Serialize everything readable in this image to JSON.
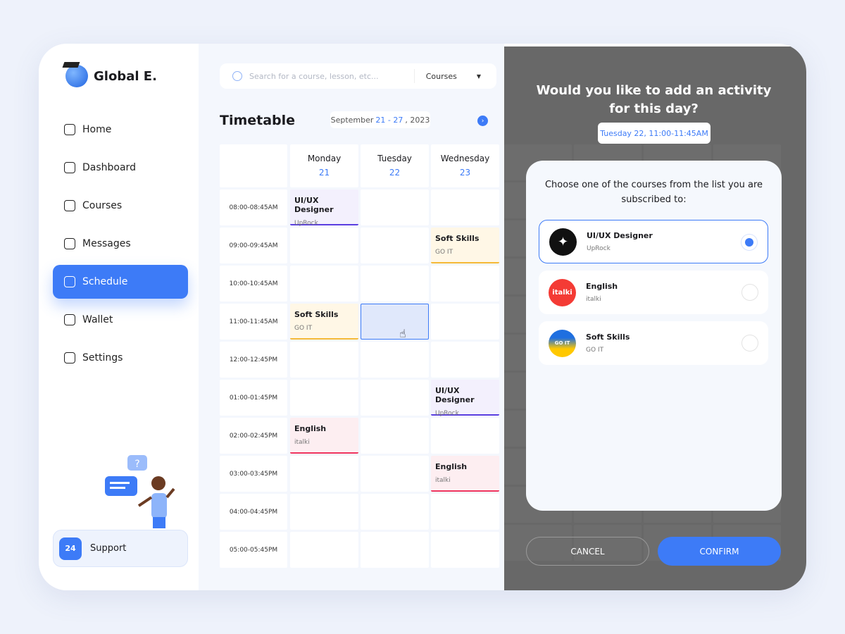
{
  "app": {
    "name": "Global E."
  },
  "sidebar": {
    "items": [
      {
        "label": "Home"
      },
      {
        "label": "Dashboard"
      },
      {
        "label": "Courses"
      },
      {
        "label": "Messages"
      },
      {
        "label": "Schedule",
        "active": true
      },
      {
        "label": "Wallet"
      },
      {
        "label": "Settings"
      }
    ],
    "support": {
      "label": "Support",
      "icon_text": "24"
    }
  },
  "search": {
    "placeholder": "Search for a course, lesson, etc...",
    "filter": "Courses"
  },
  "timetable": {
    "title": "Timetable",
    "range_prefix": "September",
    "range_days": "21 - 27",
    "range_suffix": ", 2023",
    "days": [
      {
        "name": "Monday",
        "date": "21"
      },
      {
        "name": "Tuesday",
        "date": "22"
      },
      {
        "name": "Wednesday",
        "date": "23"
      }
    ],
    "times": [
      "08:00-08:45AM",
      "09:00-09:45AM",
      "10:00-10:45AM",
      "11:00-11:45AM",
      "12:00-12:45PM",
      "01:00-01:45PM",
      "02:00-02:45PM",
      "03:00-03:45PM",
      "04:00-04:45PM",
      "05:00-05:45PM"
    ],
    "events": [
      {
        "day": 0,
        "slot": 0,
        "title": "UI/UX Designer",
        "provider": "UpRock",
        "kind": "uiux"
      },
      {
        "day": 2,
        "slot": 1,
        "title": "Soft Skills",
        "provider": "GO IT",
        "kind": "soft"
      },
      {
        "day": 0,
        "slot": 3,
        "title": "Soft Skills",
        "provider": "GO IT",
        "kind": "soft"
      },
      {
        "day": 2,
        "slot": 5,
        "title": "UI/UX Designer",
        "provider": "UpRock",
        "kind": "uiux"
      },
      {
        "day": 0,
        "slot": 6,
        "title": "English",
        "provider": "italki",
        "kind": "english"
      },
      {
        "day": 2,
        "slot": 7,
        "title": "English",
        "provider": "italki",
        "kind": "english"
      }
    ],
    "selected": {
      "day": 1,
      "slot": 3
    }
  },
  "colors": {
    "accent": "#3d7bf7",
    "uiux_bg": "#f3f0fd",
    "uiux_line": "#5b3fe0",
    "soft_bg": "#fff7e6",
    "soft_line": "#f5b937",
    "english_bg": "#fdeef1",
    "english_line": "#f0365f",
    "overlay": "#686868"
  },
  "dialog": {
    "question": "Would you like to add an activity for this day?",
    "slot": "Tuesday 22, 11:00-11:45AM",
    "prompt": "Choose one of the courses from the list you are subscribed to:",
    "options": [
      {
        "title": "UI/UX Designer",
        "provider": "UpRock",
        "selected": true
      },
      {
        "title": "English",
        "provider": "italki",
        "logo_text": "italki",
        "selected": false
      },
      {
        "title": "Soft Skills",
        "provider": "GO IT",
        "logo_text": "GO IT",
        "selected": false
      }
    ],
    "cancel": "CANCEL",
    "confirm": "CONFIRM"
  }
}
